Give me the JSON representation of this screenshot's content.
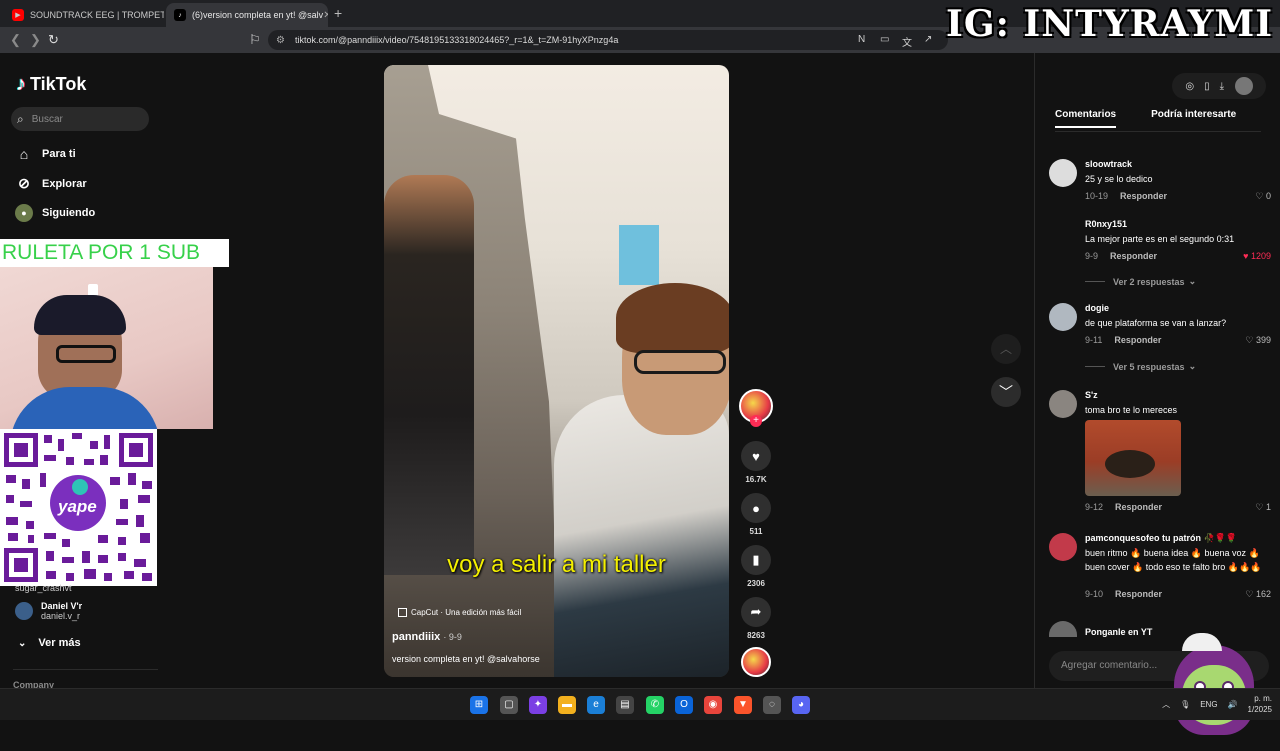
{
  "browser": {
    "tabs": [
      {
        "title": "SOUNDTRACK EEG | TROMPETAS DE",
        "favicon": "youtube-icon",
        "active": false
      },
      {
        "title": "(6)version completa en yt! @salv",
        "favicon": "tiktok-icon",
        "active": true
      }
    ],
    "new_tab": "+",
    "url": "tiktok.com/@panndiiix/video/7548195133318024465?_r=1&_t=ZM-91hyXPnzg4a"
  },
  "overlay": {
    "ig_text": "IG: INTYRAYMI",
    "ruleta_text": "RULETA POR 1 SUB",
    "qr_label": "yape"
  },
  "sidebar": {
    "logo": "TikTok",
    "search_placeholder": "Buscar",
    "nav": [
      {
        "label": "Para ti",
        "icon": "home-icon"
      },
      {
        "label": "Explorar",
        "icon": "compass-icon"
      },
      {
        "label": "Siguiendo",
        "icon": "following-icon"
      }
    ],
    "following": [
      {
        "name": "sugar_crashvt",
        "handle": ""
      },
      {
        "name": "Daniel V'r",
        "handle": "daniel.v_r"
      }
    ],
    "ver_mas": "Ver más",
    "company": "Company"
  },
  "video": {
    "caption_overlay": "voy a salir a mi taller",
    "capcut": "CapCut · Una edición más fácil",
    "author": "panndiiix",
    "date": "· 9-9",
    "description": "version completa en yt! @salvahorse"
  },
  "actions": {
    "likes": "16.7K",
    "comments": "511",
    "saves": "2306",
    "shares": "8263"
  },
  "panel": {
    "tabs": [
      "Comentarios",
      "Podría interesarte"
    ],
    "comments": [
      {
        "user": "sloowtrack",
        "text": "25 y se lo dedico",
        "date": "10-19",
        "reply": "Responder",
        "likes": "0"
      },
      {
        "user": "R0nxy151",
        "text": "La mejor parte es en el segundo 0:31",
        "date": "9-9",
        "reply": "Responder",
        "likes": "1209",
        "replies": "Ver 2 respuestas"
      },
      {
        "user": "dogie",
        "text": "de que plataforma se van a lanzar?",
        "date": "9-11",
        "reply": "Responder",
        "likes": "399",
        "replies": "Ver 5 respuestas"
      },
      {
        "user": "S'z",
        "text": "toma bro te lo mereces",
        "date": "9-12",
        "reply": "Responder",
        "likes": "1"
      },
      {
        "user": "pamconquesofeo tu patrón 🥀🌹🌹",
        "text": "buen ritmo 🔥 buena idea 🔥 buena voz 🔥 buen cover 🔥 todo eso te falto bro 🔥🔥🔥",
        "date": "9-10",
        "reply": "Responder",
        "likes": "162"
      },
      {
        "user": "Ponganle en YT",
        "text": "",
        "date": "",
        "reply": "",
        "likes": ""
      }
    ],
    "add_comment_placeholder": "Agregar comentario..."
  },
  "taskbar": {
    "lang": "ENG",
    "time": "p. m.",
    "date": "1/2025"
  }
}
